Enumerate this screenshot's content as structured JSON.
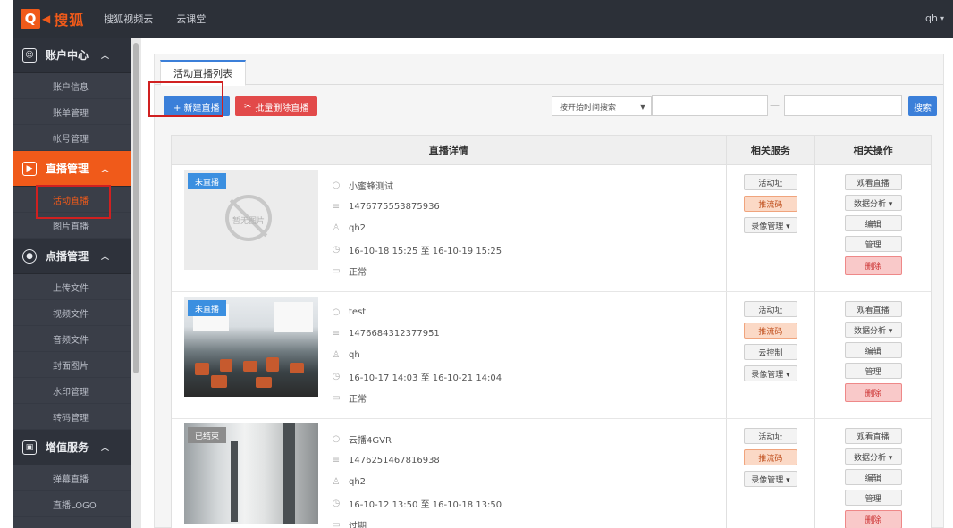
{
  "topbar": {
    "logo_text": "搜狐",
    "nav": [
      "搜狐视频云",
      "云课堂"
    ],
    "user": "qh"
  },
  "sidebar": {
    "groups": [
      {
        "label": "账户中心",
        "items": [
          "账户信息",
          "账单管理",
          "帐号管理"
        ]
      },
      {
        "label": "直播管理",
        "items": [
          "活动直播",
          "图片直播"
        ]
      },
      {
        "label": "点播管理",
        "items": [
          "上传文件",
          "视频文件",
          "音频文件",
          "封面图片",
          "水印管理",
          "转码管理"
        ]
      },
      {
        "label": "增值服务",
        "items": [
          "弹幕直播",
          "直播LOGO"
        ]
      }
    ]
  },
  "main": {
    "tab": "活动直播列表",
    "new_button": "+ 新建直播",
    "batch_button": "批量删除直播",
    "filter_select": "按开始时间搜索",
    "date_sep": "—",
    "search_button": "搜索",
    "headers": [
      "直播详情",
      "相关服务",
      "相关操作"
    ]
  },
  "rows": [
    {
      "badge": "未直播",
      "no_image_text": "暂无图片",
      "name": "小蜜蜂测试",
      "id": "1476775553875936",
      "user": "qh2",
      "time": "16-10-18 15:25 至 16-10-19 15:25",
      "status": "正常",
      "services": [
        "活动址",
        "推流码",
        "录像管理 ▾"
      ],
      "ops": [
        "观看直播",
        "数据分析 ▾",
        "编辑",
        "管理",
        "删除"
      ]
    },
    {
      "badge": "未直播",
      "name": "test",
      "id": "1476684312377951",
      "user": "qh",
      "time": "16-10-17 14:03 至 16-10-21 14:04",
      "status": "正常",
      "services": [
        "活动址",
        "推流码",
        "云控制",
        "录像管理 ▾"
      ],
      "ops": [
        "观看直播",
        "数据分析 ▾",
        "编辑",
        "管理",
        "删除"
      ]
    },
    {
      "badge": "已结束",
      "name": "云播4GVR",
      "id": "1476251467816938",
      "user": "qh2",
      "time": "16-10-12 13:50 至 16-10-18 13:50",
      "status": "过期",
      "services": [
        "活动址",
        "推流码",
        "录像管理 ▾"
      ],
      "ops": [
        "观看直播",
        "数据分析 ▾",
        "编辑",
        "管理",
        "删除"
      ]
    }
  ],
  "colors": {
    "accent": "#f05a1a",
    "primary": "#3b7fd9",
    "danger": "#e24a4a",
    "highlight_box": "#d02020"
  }
}
